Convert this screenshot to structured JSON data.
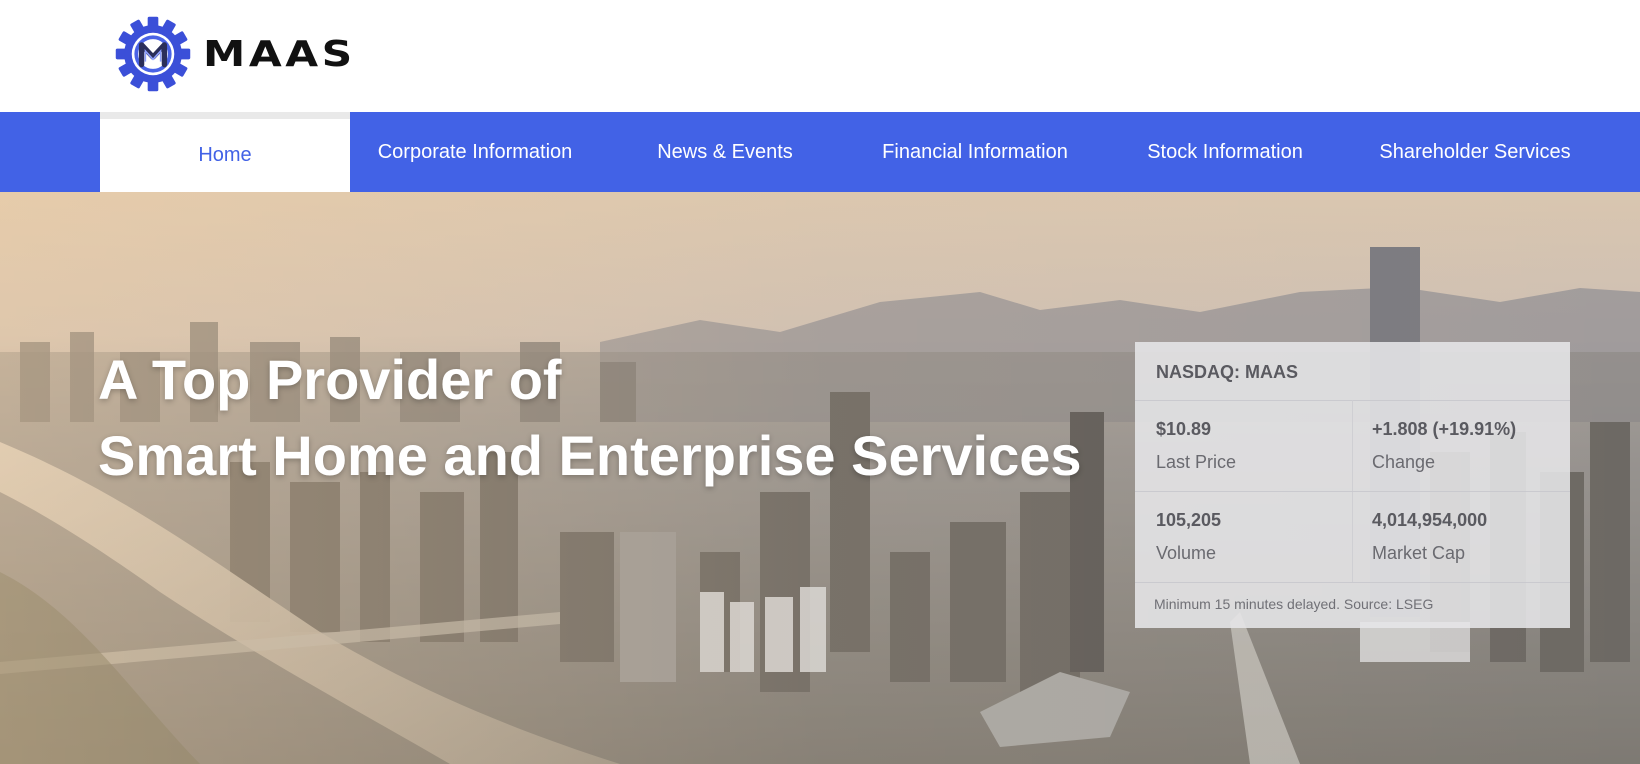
{
  "brand": {
    "name": "MAAS",
    "accent_color": "#4262e6",
    "logo_icon": "gear-m-logo-icon"
  },
  "nav": {
    "items": [
      {
        "label": "Home",
        "active": true
      },
      {
        "label": "Corporate Information",
        "active": false
      },
      {
        "label": "News & Events",
        "active": false
      },
      {
        "label": "Financial Information",
        "active": false
      },
      {
        "label": "Stock Information",
        "active": false
      },
      {
        "label": "Shareholder Services",
        "active": false
      }
    ]
  },
  "hero": {
    "headline_line1": "A Top Provider of",
    "headline_line2": "Smart Home and Enterprise Services",
    "background": "aerial-city-skyline-photo"
  },
  "stock": {
    "ticker": "NASDAQ: MAAS",
    "last_price": {
      "value": "$10.89",
      "label": "Last Price"
    },
    "change": {
      "value": "+1.808 (+19.91%)",
      "label": "Change"
    },
    "volume": {
      "value": "105,205",
      "label": "Volume"
    },
    "market_cap": {
      "value": "4,014,954,000",
      "label": "Market Cap"
    },
    "note": "Minimum 15 minutes delayed. Source: LSEG"
  }
}
